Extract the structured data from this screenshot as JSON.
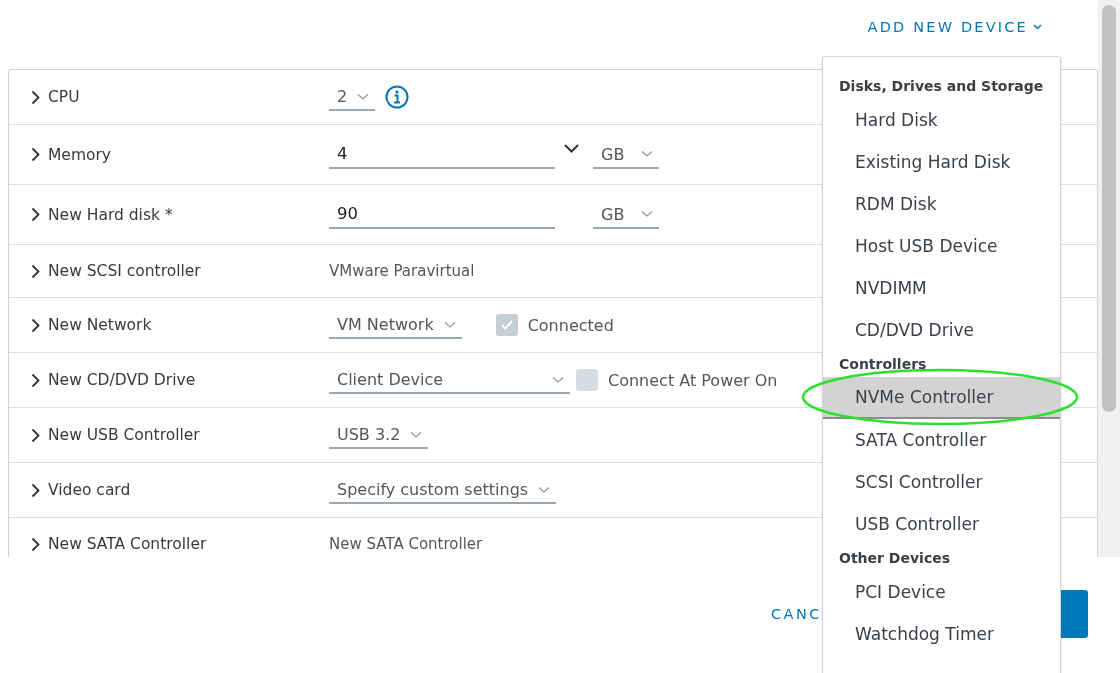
{
  "add_device_button": {
    "label": "ADD NEW DEVICE"
  },
  "rows": [
    {
      "kind": "select",
      "label": "CPU",
      "value": "2",
      "info": true
    },
    {
      "kind": "combo_unit",
      "label": "Memory",
      "value": "4",
      "unit": "GB"
    },
    {
      "kind": "input_unit",
      "label": "New Hard disk *",
      "value": "90",
      "unit": "GB"
    },
    {
      "kind": "text",
      "label": "New SCSI controller",
      "value": "VMware Paravirtual"
    },
    {
      "kind": "select_check",
      "label": "New Network",
      "value": "VM Network",
      "check_label": "Connected",
      "checked": true,
      "wide": false
    },
    {
      "kind": "select_check",
      "label": "New CD/DVD Drive",
      "value": "Client Device",
      "check_label": "Connect At Power On",
      "checked": false,
      "wide": true
    },
    {
      "kind": "select",
      "label": "New USB Controller",
      "value": "USB 3.2"
    },
    {
      "kind": "select",
      "label": "Video card",
      "value": "Specify custom settings"
    },
    {
      "kind": "text",
      "label": "New SATA Controller",
      "value": "New SATA Controller"
    }
  ],
  "footer": {
    "cancel_button": "CANC"
  },
  "menu": [
    {
      "kind": "heading",
      "label": "Disks, Drives and Storage"
    },
    {
      "kind": "item",
      "label": "Hard Disk",
      "selected": false
    },
    {
      "kind": "item",
      "label": "Existing Hard Disk",
      "selected": false
    },
    {
      "kind": "item",
      "label": "RDM Disk",
      "selected": false
    },
    {
      "kind": "item",
      "label": "Host USB Device",
      "selected": false
    },
    {
      "kind": "item",
      "label": "NVDIMM",
      "selected": false
    },
    {
      "kind": "item",
      "label": "CD/DVD Drive",
      "selected": false
    },
    {
      "kind": "heading",
      "label": "Controllers"
    },
    {
      "kind": "item",
      "label": "NVMe Controller",
      "selected": true
    },
    {
      "kind": "item",
      "label": "SATA Controller",
      "selected": false
    },
    {
      "kind": "item",
      "label": "SCSI Controller",
      "selected": false
    },
    {
      "kind": "item",
      "label": "USB Controller",
      "selected": false
    },
    {
      "kind": "heading",
      "label": "Other Devices"
    },
    {
      "kind": "item",
      "label": "PCI Device",
      "selected": false
    },
    {
      "kind": "item",
      "label": "Watchdog Timer",
      "selected": false
    }
  ]
}
